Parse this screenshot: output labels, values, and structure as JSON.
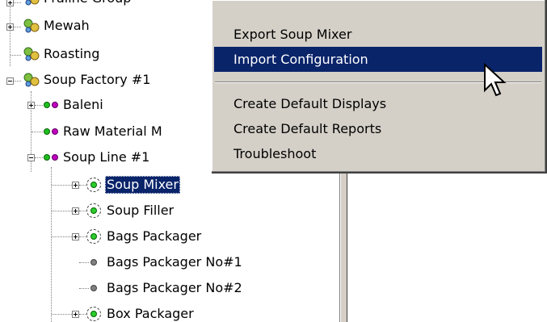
{
  "tree": {
    "nodes": [
      {
        "id": "n0",
        "label": "Praline Group",
        "icon": "org-icon"
      },
      {
        "id": "n1",
        "label": "Mewah",
        "icon": "org-icon"
      },
      {
        "id": "n2",
        "label": "Roasting",
        "icon": "org-icon"
      },
      {
        "id": "n3",
        "label": "Soup Factory #1",
        "icon": "org-icon"
      },
      {
        "id": "n4",
        "label": "Baleni",
        "icon": "two-dots-icon"
      },
      {
        "id": "n5",
        "label": "Raw Material M",
        "icon": "two-dots-icon"
      },
      {
        "id": "n6",
        "label": "Soup Line #1",
        "icon": "two-dots-icon"
      },
      {
        "id": "n7",
        "label": "Soup Mixer",
        "icon": "green-ring-icon",
        "selected": true
      },
      {
        "id": "n8",
        "label": "Soup Filler",
        "icon": "green-ring-icon"
      },
      {
        "id": "n9",
        "label": "Bags Packager",
        "icon": "green-ring-icon"
      },
      {
        "id": "n10",
        "label": "Bags Packager No#1",
        "icon": "grey-dot-icon"
      },
      {
        "id": "n11",
        "label": "Bags Packager No#2",
        "icon": "grey-dot-icon"
      },
      {
        "id": "n12",
        "label": "Box Packager",
        "icon": "green-ring-icon"
      }
    ]
  },
  "context_menu": {
    "items": [
      {
        "label": "Export Soup Mixer"
      },
      {
        "label": "Import Configuration",
        "highlighted": true
      },
      {
        "label": "Create Default Displays"
      },
      {
        "label": "Create Default Reports"
      },
      {
        "label": "Troubleshoot"
      }
    ]
  },
  "colors": {
    "selection": "#0a246a",
    "menu_background": "#d4d0c8",
    "two_dots_green": "#1fbf1f",
    "two_dots_magenta": "#c000c0",
    "ring_green": "#2bcc2b"
  }
}
